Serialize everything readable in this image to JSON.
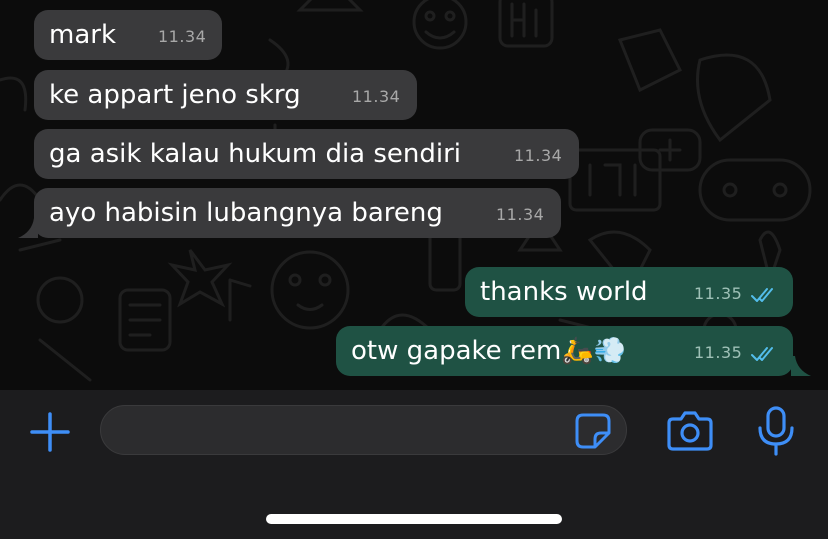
{
  "messages": [
    {
      "text": "mark",
      "time": "11.34",
      "direction": "incoming"
    },
    {
      "text": "ke appart jeno skrg",
      "time": "11.34",
      "direction": "incoming"
    },
    {
      "text": "ga asik kalau hukum dia sendiri",
      "time": "11.34",
      "direction": "incoming"
    },
    {
      "text": "ayo habisin lubangnya bareng",
      "time": "11.34",
      "direction": "incoming"
    },
    {
      "text": "thanks world",
      "time": "11.35",
      "direction": "outgoing",
      "status": "read"
    },
    {
      "text": "otw gapake rem🛵💨",
      "time": "11.35",
      "direction": "outgoing",
      "status": "read"
    }
  ],
  "composer": {
    "input_value": "",
    "icons": [
      "plus-icon",
      "sticker-icon",
      "camera-icon",
      "microphone-icon"
    ]
  },
  "colors": {
    "chat_background": "#0c0c0c",
    "incoming_bubble": "#3a3a3c",
    "outgoing_bubble": "#1f5244",
    "read_ticks": "#53bdeb",
    "accent": "#3e8ef7",
    "composer_bar": "#1c1c1e"
  }
}
